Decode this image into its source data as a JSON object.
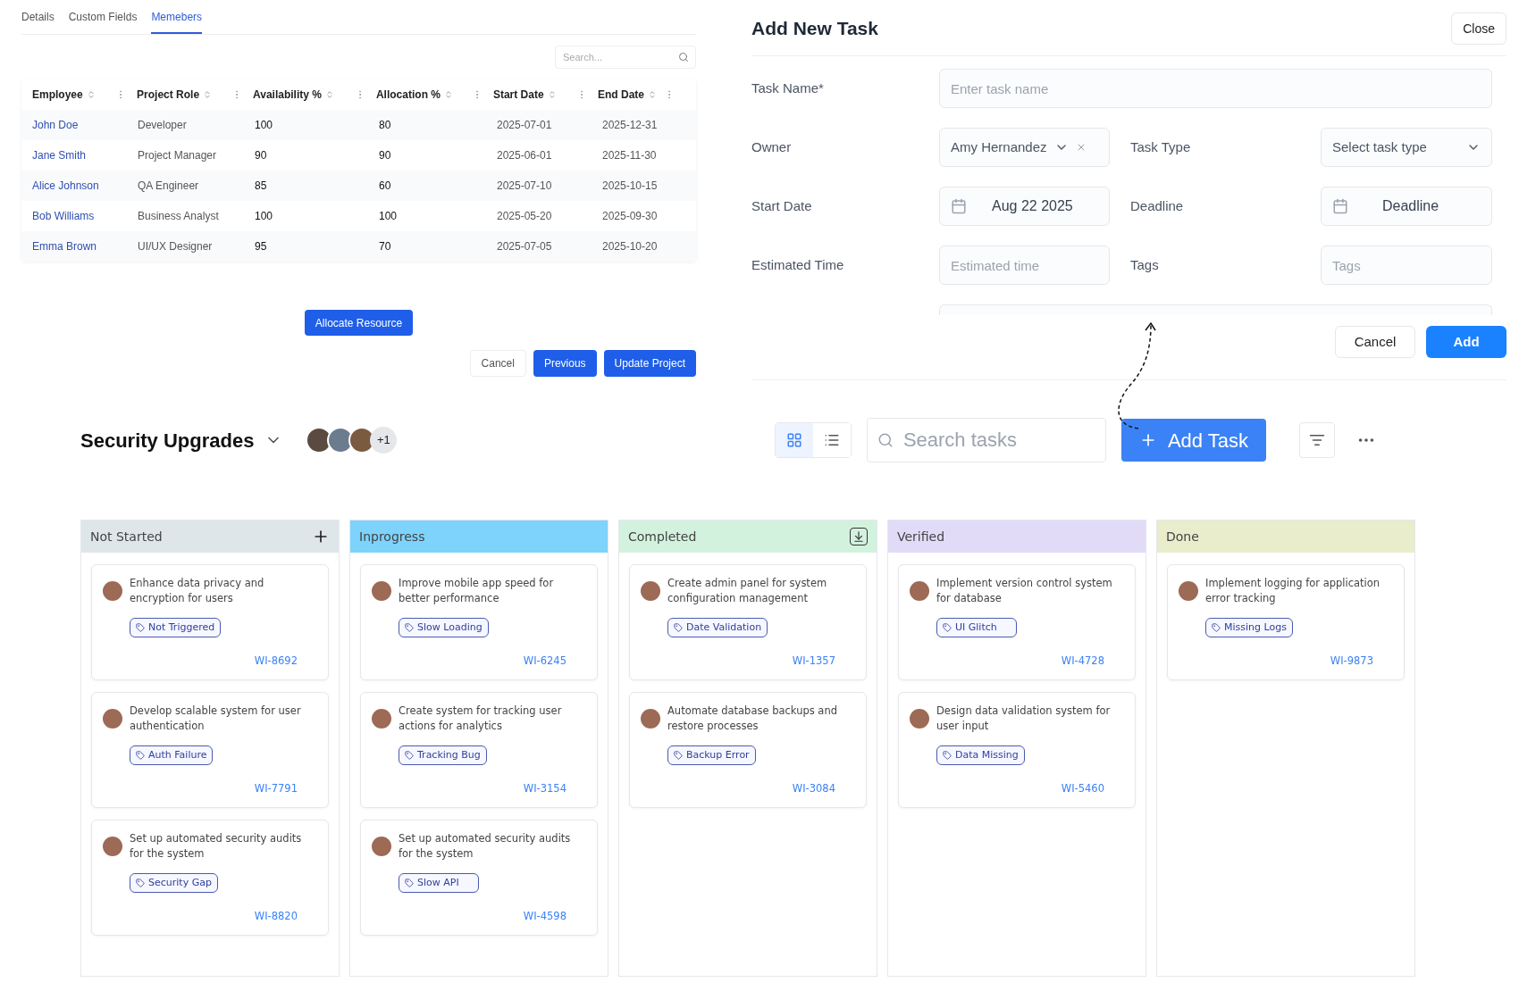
{
  "members_panel": {
    "tabs": [
      {
        "label": "Details",
        "selected": false
      },
      {
        "label": "Custom Fields",
        "selected": false
      },
      {
        "label": "Memebers",
        "selected": true
      }
    ],
    "search": {
      "placeholder": "Search..."
    },
    "table": {
      "columns": [
        "Employee",
        "Project Role",
        "Availability %",
        "Allocation %",
        "Start Date",
        "End Date"
      ],
      "rows": [
        [
          "John Doe",
          "Developer",
          "100",
          "80",
          "2025-07-01",
          "2025-12-31"
        ],
        [
          "Jane Smith",
          "Project Manager",
          "90",
          "90",
          "2025-06-01",
          "2025-11-30"
        ],
        [
          "Alice Johnson",
          "QA Engineer",
          "85",
          "60",
          "2025-07-10",
          "2025-10-15"
        ],
        [
          "Bob Williams",
          "Business Analyst",
          "100",
          "100",
          "2025-05-20",
          "2025-09-30"
        ],
        [
          "Emma Brown",
          "UI/UX Designer",
          "95",
          "70",
          "2025-07-05",
          "2025-10-20"
        ]
      ]
    },
    "allocate_button": "Allocate Resource",
    "buttons": [
      "Cancel",
      "Previous",
      "Update Project"
    ]
  },
  "task_form": {
    "title": "Add New Task",
    "close_button": "Close",
    "task_name": {
      "label": "Task Name*",
      "placeholder": "Enter task name"
    },
    "owner": {
      "label": "Owner",
      "value": "Amy Hernandez"
    },
    "task_type": {
      "label": "Task Type",
      "placeholder": "Select task type"
    },
    "start_date": {
      "label": "Start Date",
      "value": "Aug 22 2025"
    },
    "deadline": {
      "label": "Deadline",
      "placeholder": "Deadline"
    },
    "estimated_time": {
      "label": "Estimated Time",
      "placeholder": "Estimated time"
    },
    "tags": {
      "label": "Tags",
      "placeholder": "Tags"
    },
    "cancel_button": "Cancel",
    "add_button": "Add"
  },
  "board_header": {
    "title": "Security Upgrades",
    "extra_members": "+1",
    "views": [
      {
        "kind": "grid",
        "selected": true
      },
      {
        "kind": "list",
        "selected": false
      }
    ],
    "search": {
      "placeholder": "Search tasks"
    },
    "add_button": "Add Task"
  },
  "columns": [
    {
      "title": "Not Started",
      "color": "#dfe6e9",
      "kind": "addable",
      "cards": [
        {
          "title": "Enhance data privacy and encryption for users",
          "tag": "Not Triggered",
          "id": "WI-8692"
        },
        {
          "title": "Develop scalable system for user authentication",
          "tag": "Auth Failure",
          "id": "WI-7791"
        },
        {
          "title": "Set up automated security audits for the system",
          "tag": "Security Gap",
          "id": "WI-8820"
        }
      ]
    },
    {
      "title": "Inprogress",
      "color": "#7dd3fc",
      "kind": "plain",
      "cards": [
        {
          "title": "Improve mobile app speed for better performance",
          "tag": "Slow Loading",
          "id": "WI-6245"
        },
        {
          "title": "Create system for tracking user actions for analytics",
          "tag": "Tracking Bug",
          "id": "WI-3154"
        },
        {
          "title": "Set up automated security audits for the system",
          "tag": "Slow API",
          "id": "WI-4598"
        }
      ]
    },
    {
      "title": "Completed",
      "color": "#d3f2de",
      "kind": "archivable",
      "cards": [
        {
          "title": "Create admin panel for system configuration management",
          "tag": "Date Validation",
          "id": "WI-1357"
        },
        {
          "title": "Automate database backups and restore processes",
          "tag": "Backup Error",
          "id": "WI-3084"
        }
      ]
    },
    {
      "title": "Verified",
      "color": "#e2dbf8",
      "kind": "plain",
      "cards": [
        {
          "title": "Implement version control system for database",
          "tag": "UI Glitch",
          "id": "WI-4728"
        },
        {
          "title": "Design data validation system for user input",
          "tag": "Data Missing",
          "id": "WI-5460"
        }
      ]
    },
    {
      "title": "Done",
      "color": "#e9edcc",
      "kind": "plain",
      "cards": [
        {
          "title": "Implement logging for application error tracking",
          "tag": "Missing Logs",
          "id": "WI-9873"
        }
      ]
    }
  ]
}
